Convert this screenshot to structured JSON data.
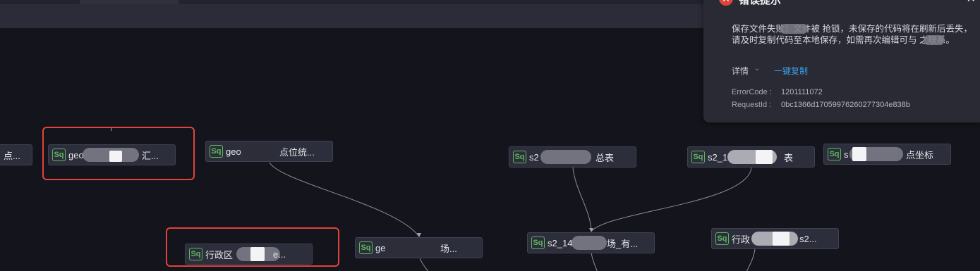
{
  "nodes": [
    {
      "label": "点..."
    },
    {
      "label": "geo",
      "label2": "汇..."
    },
    {
      "label": "geo",
      "label2": "点位统..."
    },
    {
      "label": "s2",
      "label2": "总表"
    },
    {
      "label": "s2_1",
      "label2": "表"
    },
    {
      "label": "s",
      "label2": "点坐标"
    },
    {
      "label": "行政区",
      "label2": "e..."
    },
    {
      "label": "ge",
      "label2": "场..."
    },
    {
      "label": "s2_14",
      "label2": "场_有..."
    },
    {
      "label": "行政",
      "label2": "s2..."
    }
  ],
  "node_icon_text": "Sq",
  "error": {
    "title": "错误提示",
    "message": "保存文件失败！文件被     抢锁，未保存的代码将在刷新后丢失，请及时复制代码至本地保存，如需再次编辑可与      之联系。",
    "detail_label": "详情",
    "copy_label": "一键复制",
    "error_code_key": "ErrorCode :",
    "error_code_value": "1201111072",
    "request_id_key": "RequestId :",
    "request_id_value": "0bc1366d17059976260277304e838b"
  },
  "colors": {
    "highlight": "#e0433a",
    "sq_icon": "#5cb85c",
    "link": "#3aa0ea"
  }
}
